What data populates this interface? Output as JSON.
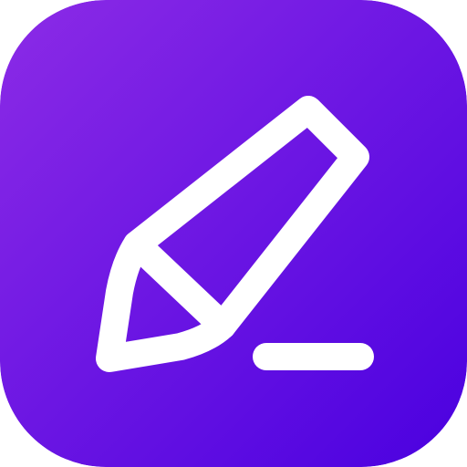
{
  "app_icon": {
    "name": "pencil-edit-app-icon",
    "glyph": "pencil-icon",
    "underline": "underline-stroke",
    "colors": {
      "gradient_start": "#8C2BE6",
      "gradient_end": "#4A00E0",
      "glyph": "#FFFFFF"
    }
  }
}
